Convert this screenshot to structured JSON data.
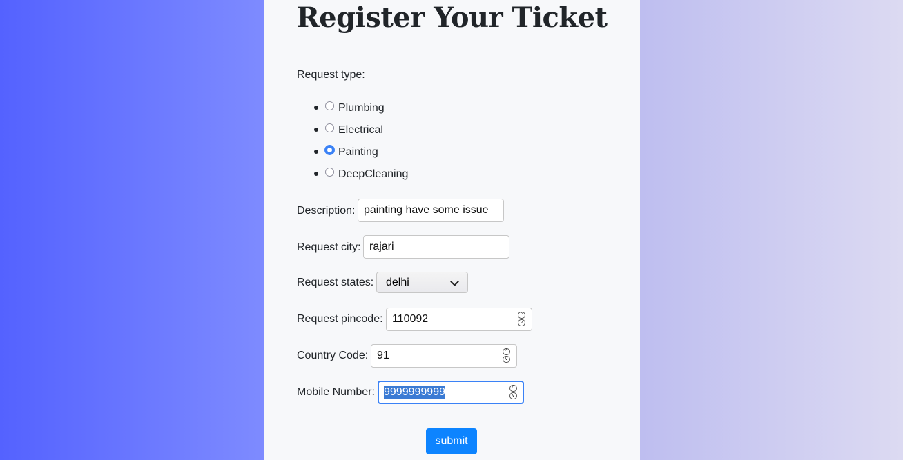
{
  "form": {
    "title": "Register Your Ticket",
    "request_type_label": "Request type:",
    "request_types": [
      {
        "label": "Plumbing",
        "checked": false
      },
      {
        "label": "Electrical",
        "checked": false
      },
      {
        "label": "Painting",
        "checked": true
      },
      {
        "label": "DeepCleaning",
        "checked": false
      }
    ],
    "description_label": "Description:",
    "description_value": "painting have some issue",
    "city_label": "Request city:",
    "city_value": "rajari",
    "state_label": "Request states:",
    "state_value": "delhi",
    "pincode_label": "Request pincode:",
    "pincode_value": "110092",
    "country_code_label": "Country Code:",
    "country_code_value": "91",
    "mobile_label": "Mobile Number:",
    "mobile_value": "9999999999",
    "submit_label": "submit"
  },
  "colors": {
    "accent": "#0d84ff",
    "radio_checked": "#3b82f6",
    "panel_bg": "#f7f8fa"
  },
  "icons": {
    "select_arrow": "chevron-down-icon",
    "spinner_up": "chevron-up-icon",
    "spinner_down": "chevron-down-icon"
  }
}
